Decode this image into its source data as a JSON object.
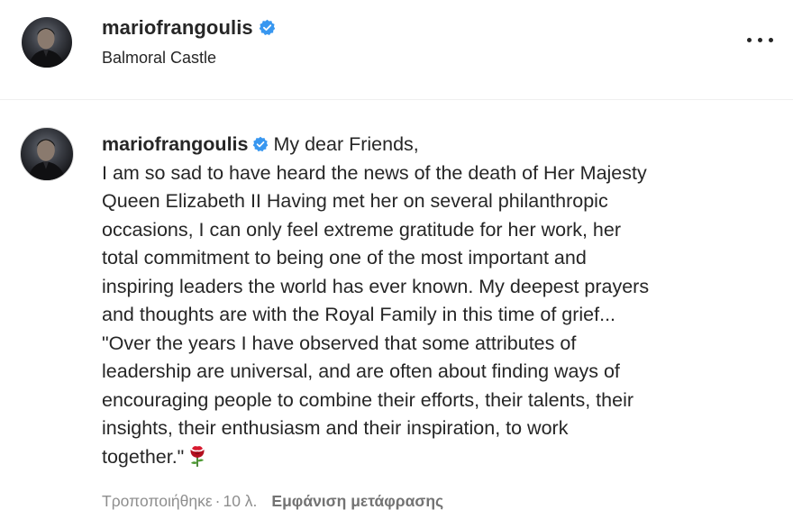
{
  "header": {
    "username": "mariofrangoulis",
    "location": "Balmoral Castle"
  },
  "comment": {
    "username": "mariofrangoulis",
    "lines": [
      "My dear Friends,",
      "I am so sad to have heard the news of the death of Her Majesty",
      "Queen Elizabeth II Having met her on several philanthropic",
      "occasions, I can only feel extreme gratitude for her work, her",
      "total commitment to being one of the most important and",
      "inspiring leaders the world has ever known. My deepest prayers",
      "and thoughts are with the Royal Family in this time of grief...",
      "\"Over the years I have observed that some attributes of",
      "leadership are universal, and are often about finding ways of",
      "encouraging people to combine their efforts, their talents, their",
      "insights, their enthusiasm and their inspiration, to work",
      "together.\""
    ],
    "emoji": "rose-emoji"
  },
  "meta": {
    "edited": "Τροποποιήθηκε",
    "separator": "·",
    "time": "10 λ.",
    "translate": "Εμφάνιση μετάφρασης"
  },
  "icons": {
    "verified": "verified-badge-icon",
    "more": "more-options-icon"
  },
  "colors": {
    "verified_blue": "#3897f0",
    "text": "#262626",
    "muted": "#8e8e8e",
    "rose_red": "#c8102e"
  }
}
